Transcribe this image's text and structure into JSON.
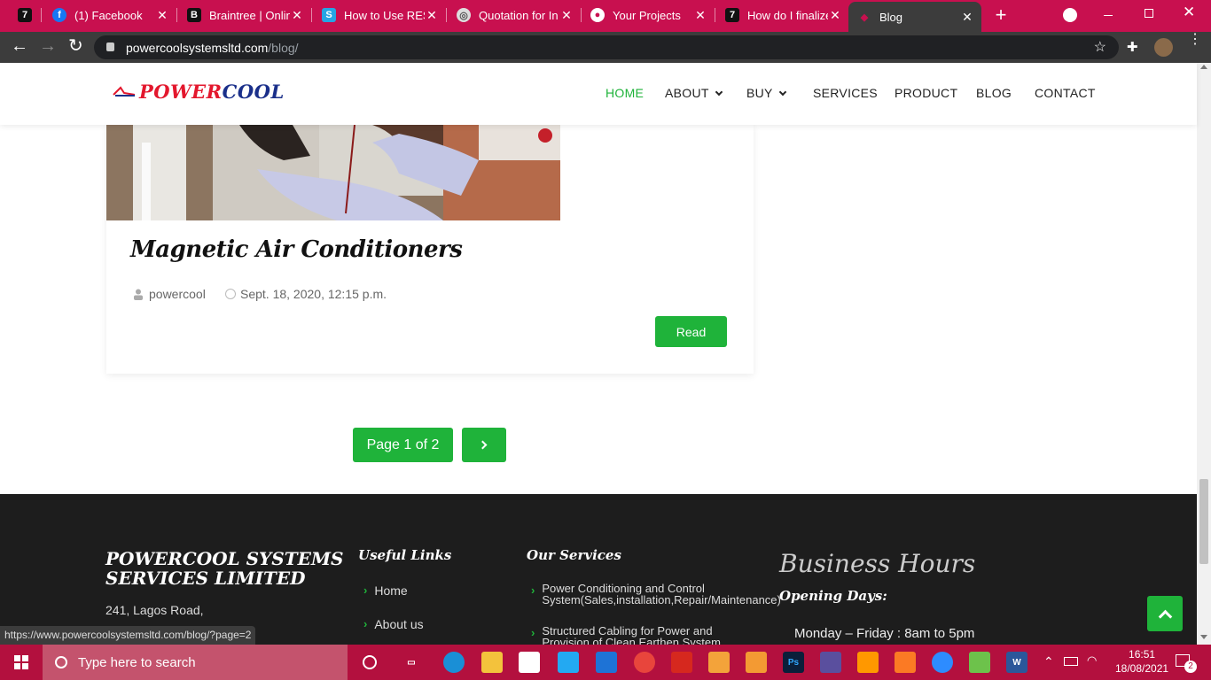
{
  "browser": {
    "tabs": [
      {
        "label": "",
        "icon": "7",
        "icon_bg": "#111111",
        "closable": false
      },
      {
        "label": "(1) Facebook",
        "icon": "f",
        "icon_bg": "#1877f2",
        "closable": true
      },
      {
        "label": "Braintree | Onlin",
        "icon": "B",
        "icon_bg": "#111111",
        "closable": true
      },
      {
        "label": "How to Use RES",
        "icon": "S",
        "icon_bg": "#26a5e4",
        "closable": true
      },
      {
        "label": "Quotation for In",
        "icon": "◎",
        "icon_bg": "#dddddd",
        "closable": true
      },
      {
        "label": "Your Projects",
        "icon": "●",
        "icon_bg": "#ffffff",
        "closable": true
      },
      {
        "label": "How do I finalize",
        "icon": "7",
        "icon_bg": "#111111",
        "closable": true
      },
      {
        "label": "Blog",
        "icon": "",
        "icon_bg": "#3c3c3c",
        "closable": true
      }
    ],
    "url_host": "powercoolsystemsltd.com",
    "url_path": "/blog/",
    "status_url": "https://www.powercoolsystemsltd.com/blog/?page=2"
  },
  "site": {
    "logo_power": "POWER",
    "logo_cool": "COOL",
    "nav": [
      {
        "label": "HOME",
        "active": true,
        "dropdown": false
      },
      {
        "label": "ABOUT",
        "active": false,
        "dropdown": true
      },
      {
        "label": "BUY",
        "active": false,
        "dropdown": true
      },
      {
        "label": "SERVICES",
        "active": false,
        "dropdown": false
      },
      {
        "label": "PRODUCT",
        "active": false,
        "dropdown": false
      },
      {
        "label": "BLOG",
        "active": false,
        "dropdown": false
      },
      {
        "label": "CONTACT",
        "active": false,
        "dropdown": false
      }
    ]
  },
  "post": {
    "title": "Magnetic Air Conditioners",
    "author": "powercool",
    "date": "Sept. 18, 2020, 12:15 p.m.",
    "read_label": "Read"
  },
  "pagination": {
    "label": "Page 1 of 2"
  },
  "footer": {
    "company_line1": "POWERCOOL SYSTEMS",
    "company_line2": "SERVICES LIMITED",
    "address": "241, Lagos Road,",
    "useful_links_title": "Useful Links",
    "useful_links": [
      "Home",
      "About us"
    ],
    "services_title": "Our Services",
    "services": [
      "Power Conditioning and Control System(Sales,installation,Repair/Maintenance)",
      "Structured Cabling for Power and Provision of Clean Earthen System"
    ],
    "hours_title": "Business Hours",
    "opening_days_title": "Opening Days:",
    "hours_line": "Monday – Friday : 8am to 5pm"
  },
  "taskbar": {
    "search_placeholder": "Type here to search",
    "time": "16:51",
    "date": "18/08/2021",
    "notifications": "2"
  },
  "colors": {
    "accent_green": "#1fb33a",
    "tabbar": "#c8104f",
    "taskbar": "#b3103e",
    "footer_bg": "#1d1d1d",
    "logo_red": "#e3172d",
    "logo_blue": "#1a2f8a"
  }
}
